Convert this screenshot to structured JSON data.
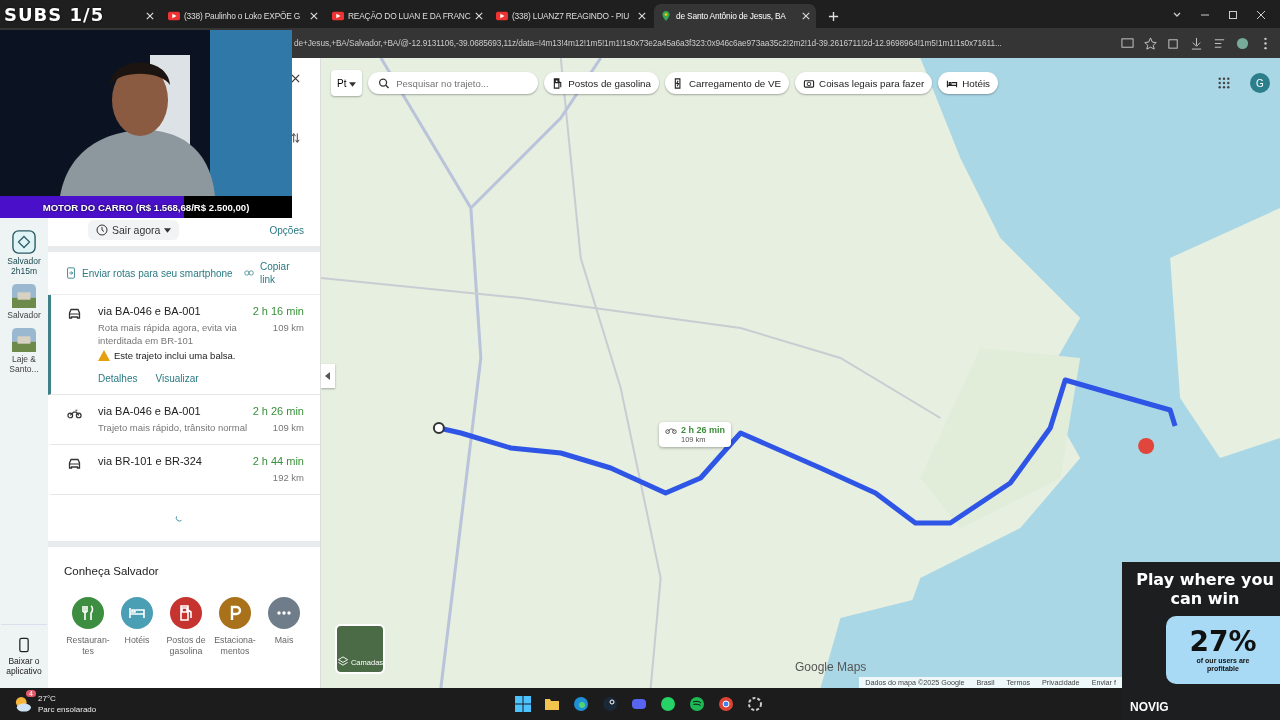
{
  "stream_overlay": {
    "subs": "SUBS 1/5",
    "goal": {
      "label": "MOTOR DO CARRO (R$ 1.568,68/R$ 2.500,00)",
      "level": 0.63
    }
  },
  "tabs": [
    {
      "selected": false
    },
    {
      "title": "(338) Paulinho o Loko EXPÕE G",
      "selected": false
    },
    {
      "title": "REAÇÃO DO LUAN E DA FRANC",
      "selected": false
    },
    {
      "title": "(338) LUANZ7 REAGINDO - PIU",
      "selected": false
    },
    {
      "title": "de Santo Antônio de Jesus, BA",
      "selected": true
    }
  ],
  "address_bar": {
    "url": "de+Jesus,+BA/Salvador,+BA/@-12.9131106,-39.0685693,11z/data=!4m13!4m12!1m5!1m1!1s0x73e2a45a6a3f323:0x946c6ae973aa35c2!2m2!1d-39.2616711!2d-12.9698964!1m5!1m1!1s0x71611..."
  },
  "rail": {
    "items": [
      {
        "kind": "route",
        "label": "Salvador 2h15m",
        "selected": true
      },
      {
        "label": "Salvador",
        "selected": false
      },
      {
        "label": "Laje & Santo...",
        "selected": false
      }
    ],
    "download": "Baixar o aplicativo"
  },
  "panel": {
    "depart": "Sair agora",
    "options": "Opções",
    "send": "Enviar rotas para seu smartphone",
    "copy": "Copiar link",
    "routes": [
      {
        "kind": "car",
        "name": "via BA-046 e BA-001",
        "time": "2 h 16 min",
        "distance": "109 km",
        "note": "Rota mais rápida agora, evita via interditada em BR-101",
        "warning": "Este trajeto inclui uma balsa.",
        "links": [
          "Detalhes",
          "Visualizar"
        ],
        "selected": true
      },
      {
        "kind": "moto",
        "name": "via BA-046 e BA-001",
        "time": "2 h 26 min",
        "distance": "109 km",
        "note": "Trajeto mais rápido, trânsito normal",
        "selected": false
      },
      {
        "kind": "car",
        "name": "via BR-101 e BR-324",
        "time": "2 h 44 min",
        "distance": "192 km",
        "selected": false
      }
    ],
    "explore_title": "Conheça Salvador",
    "categories": [
      {
        "kind": "food",
        "label": "Restauran-tes",
        "color": "#3e8e41"
      },
      {
        "kind": "hotel",
        "label": "Hotéis",
        "color": "#4a9fb5"
      },
      {
        "kind": "fuel",
        "label": "Postos de gasolina",
        "color": "#c5342f"
      },
      {
        "kind": "parking",
        "label": "Estaciona-mentos",
        "color": "#a8711a"
      },
      {
        "kind": "more",
        "label": "Mais",
        "color": "#6f7d8a"
      }
    ]
  },
  "map": {
    "mode": "Pt",
    "search": {
      "placeholder": "Pesquisar no trajeto..."
    },
    "chips": [
      {
        "kind": "fuel",
        "label": "Postos de gasolina"
      },
      {
        "kind": "ev",
        "label": "Carregamento de VE"
      },
      {
        "kind": "camera",
        "label": "Coisas legais para fazer"
      },
      {
        "kind": "bed",
        "label": "Hotéis"
      }
    ],
    "avatar": "G",
    "route_callout": {
      "time": "2 h 26 min",
      "distance": "109 km"
    },
    "layers": "Camadas",
    "logo": "Google Maps",
    "footer": [
      "Dados do mapa ©2025 Google",
      "Brasil",
      "Termos",
      "Privacidade",
      "Enviar f"
    ]
  },
  "ad": {
    "headline": "Play where you can win",
    "stat": "27%",
    "stat_note": "of our users are profitable",
    "brand": "NOVIG"
  },
  "taskbar": {
    "weather_badge": "4",
    "temperature": "27°C",
    "condition": "Parc ensolarado"
  }
}
